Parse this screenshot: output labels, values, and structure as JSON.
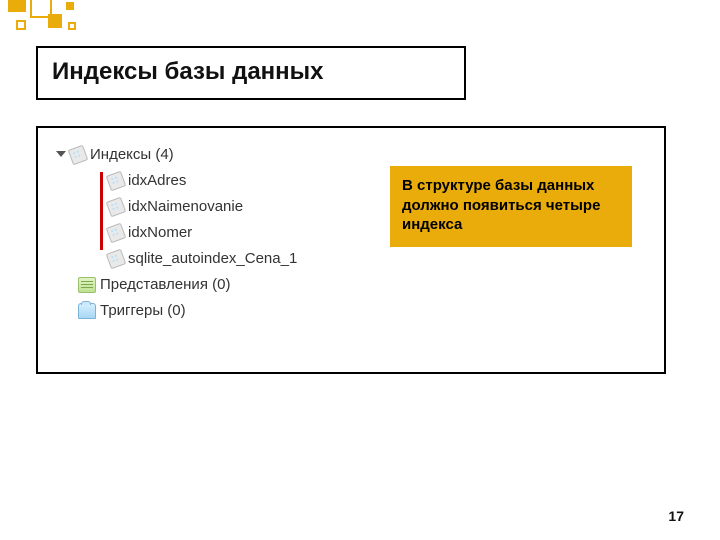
{
  "title": "Индексы базы данных",
  "tree": {
    "root_label": "Индексы (4)",
    "items": [
      "idxAdres",
      "idxNaimenovanie",
      "idxNomer",
      "sqlite_autoindex_Cena_1"
    ],
    "views_label": "Представления (0)",
    "triggers_label": "Триггеры (0)"
  },
  "callout": "В структуре базы данных должно появиться четыре индекса",
  "page_number": "17"
}
